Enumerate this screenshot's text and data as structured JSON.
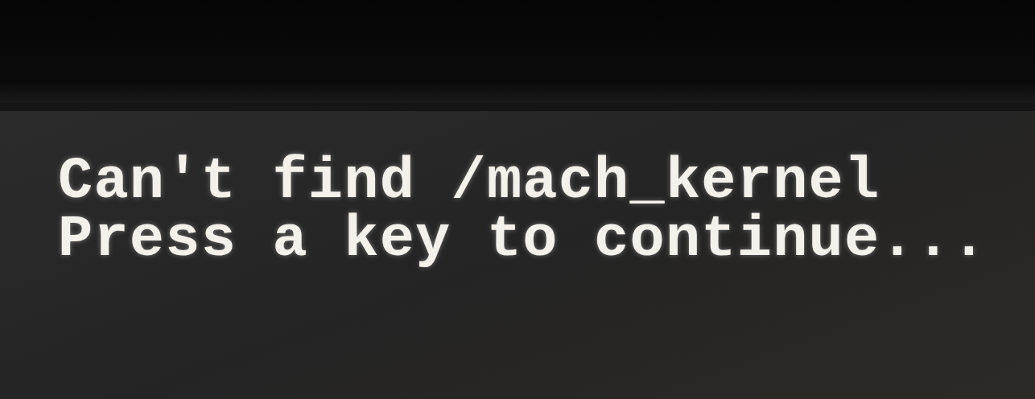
{
  "screen": {
    "lines": [
      "Can't find /mach_kernel",
      "Press a key to continue..."
    ]
  }
}
